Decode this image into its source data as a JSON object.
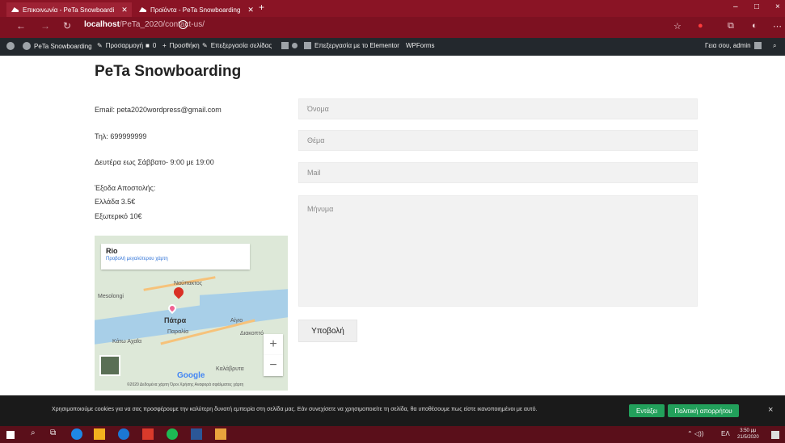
{
  "browser": {
    "tabs": [
      {
        "title": "Επικοινωνία - PeTa Snowboardi",
        "active": true
      },
      {
        "title": "Προϊόντα - PeTa Snowboarding",
        "active": false
      }
    ],
    "new_tab": "+",
    "url_host": "localhost",
    "url_path": "/PeTa_2020/contact-us/",
    "window_controls": [
      "–",
      "□",
      "×"
    ]
  },
  "admin_bar": {
    "site_name": "PeTa Snowboarding",
    "customize": "Προσαρμογή",
    "comments_count": "0",
    "new": "Προσθήκη",
    "edit_page": "Επεξεργασία σελίδας",
    "edit_elementor": "Επεξεργασία με το Elementor",
    "wpforms": "WPForms",
    "greeting": "Γεια σου, admin"
  },
  "page": {
    "site_title": "PeTa Snowboarding",
    "email": "Email: peta2020wordpress@gmail.com",
    "phone": "Τηλ: 699999999",
    "hours": "Δευτέρα εως Σάββατο- 9:00 με 19:00",
    "shipping_title": "Έξοδα Αποστολής:",
    "shipping_greece": "Ελλάδα 3.5€",
    "shipping_abroad": "Εξωτερικό 10€"
  },
  "form": {
    "name_placeholder": "Όνομα",
    "subject_placeholder": "Θέμα",
    "mail_placeholder": "Mail",
    "message_placeholder": "Μήνυμα",
    "submit_label": "Υποβολή"
  },
  "map": {
    "place_title": "Rio",
    "larger_map_link": "Προβολή μεγαλύτερου χάρτη",
    "cities": [
      "Mesolongi",
      "Ναύπακτος",
      "Πάτρα",
      "Αίγιο",
      "Παραλία",
      "Κάτω Αχαΐα",
      "Καλάβρυτα",
      "Διακοπτό"
    ],
    "zoom_in": "+",
    "zoom_out": "−",
    "google_label": "Google",
    "footer": "©2020 Δεδομένα χάρτη   Όροι Χρήσης   Αναφορά σφάλματος χάρτη"
  },
  "cookie_bar": {
    "text": "Χρησιμοποιούμε cookies για να σας προσφέρουμε την καλύτερη δυνατή εμπειρία στη σελίδα μας. Εάν συνεχίσετε να χρησιμοποιείτε τη σελίδα, θα υποθέσουμε πως είστε ικανοποιημένοι με αυτό.",
    "accept_label": "Εντάξει",
    "policy_label": "Πολιτική απορρήτου",
    "close": "×"
  },
  "taskbar": {
    "language": "ΕΛ",
    "time": "3:50 μμ",
    "date": "21/5/2020"
  }
}
